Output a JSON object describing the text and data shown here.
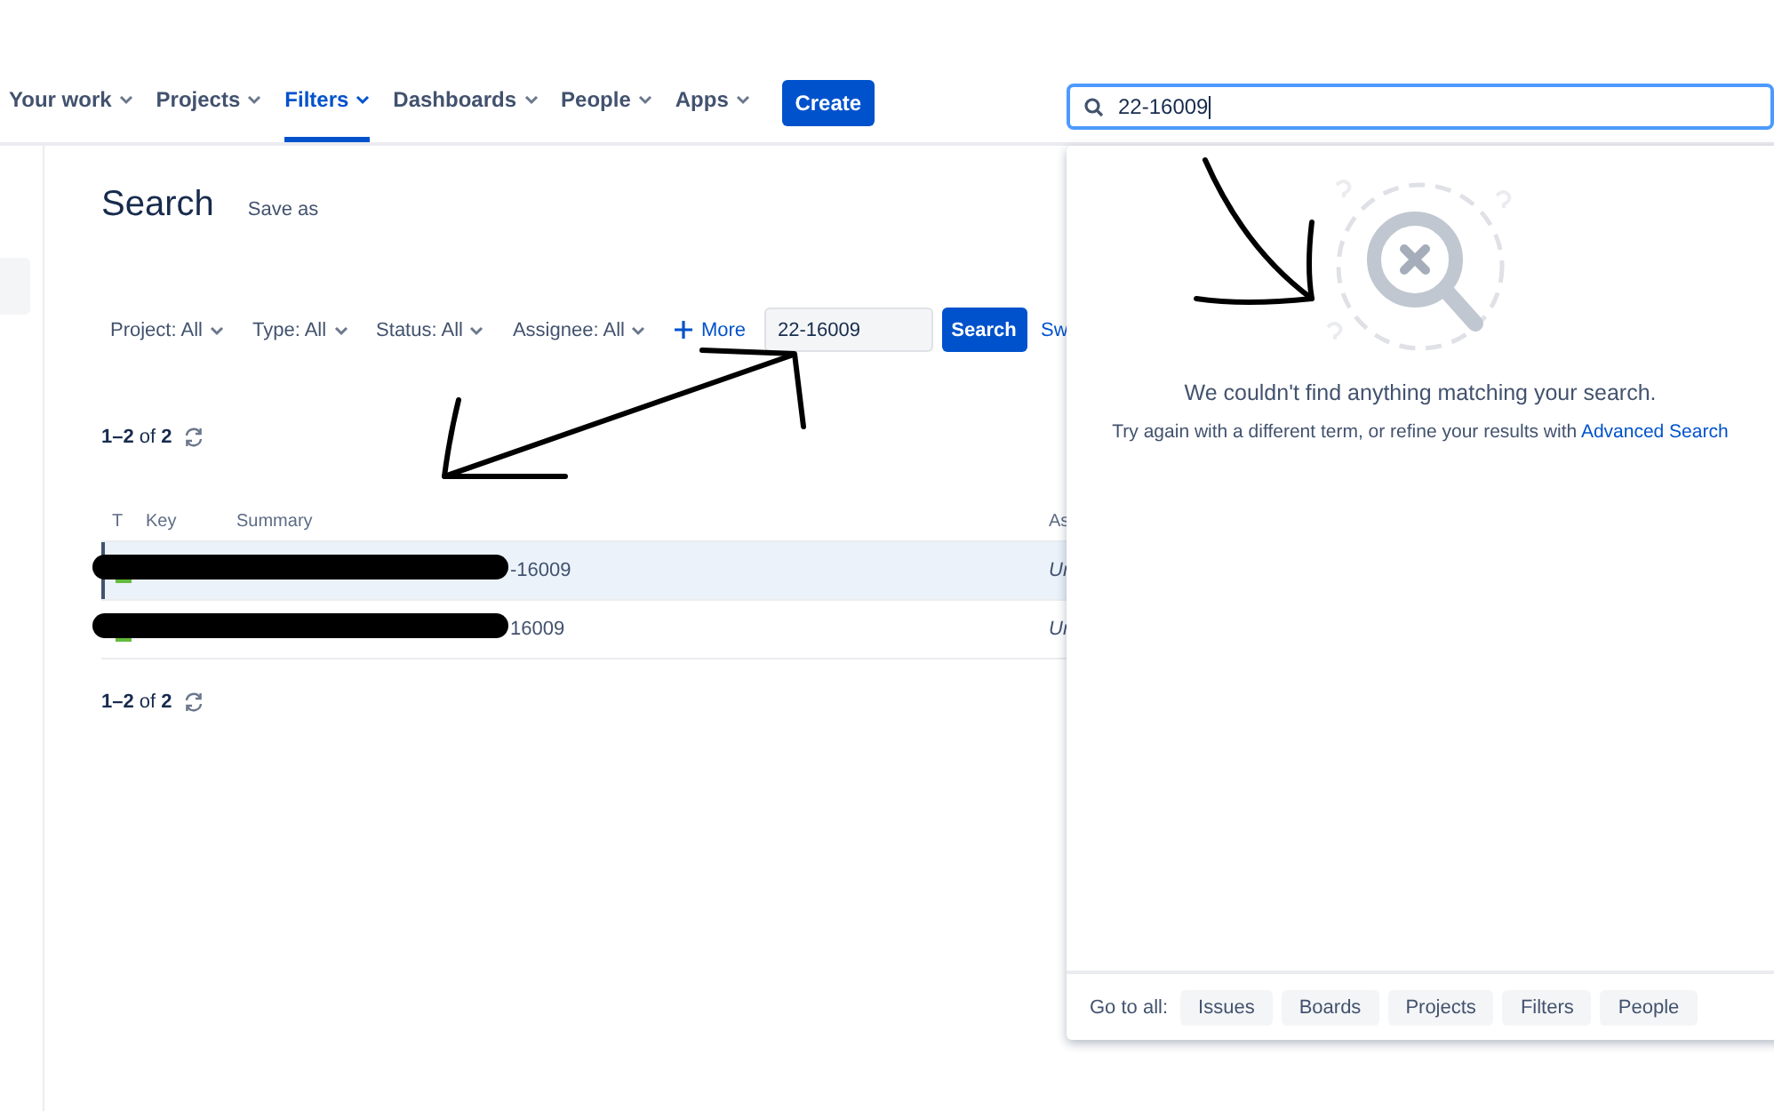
{
  "nav": {
    "items": [
      {
        "label": "Your work",
        "selected": false
      },
      {
        "label": "Projects",
        "selected": false
      },
      {
        "label": "Filters",
        "selected": true
      },
      {
        "label": "Dashboards",
        "selected": false
      },
      {
        "label": "People",
        "selected": false
      },
      {
        "label": "Apps",
        "selected": false
      }
    ],
    "create": "Create"
  },
  "global_search": {
    "value": "22-16009"
  },
  "page": {
    "title": "Search",
    "save_as": "Save as"
  },
  "filters": [
    "Project: All",
    "Type: All",
    "Status: All",
    "Assignee: All"
  ],
  "more": "More",
  "query": "22-16009",
  "search_button": "Search",
  "switch_link": "Sw",
  "counts": [
    "**1–2** of **2**",
    "**1–2** of **2**"
  ],
  "table": {
    "columns": [
      "T",
      "Key",
      "Summary",
      "As"
    ],
    "rows": [
      {
        "selected": true,
        "key": "-16009",
        "assignee": "Ur"
      },
      {
        "selected": false,
        "key": "16009",
        "assignee": "Ur"
      }
    ]
  },
  "dropdown": {
    "title": "We couldn't find anything matching your search.",
    "text": "Try again with a different term, or refine your results with",
    "link": "Advanced Search",
    "goto_label": "Go to all:",
    "goto": [
      "Issues",
      "Boards",
      "Projects",
      "Filters",
      "People"
    ]
  }
}
